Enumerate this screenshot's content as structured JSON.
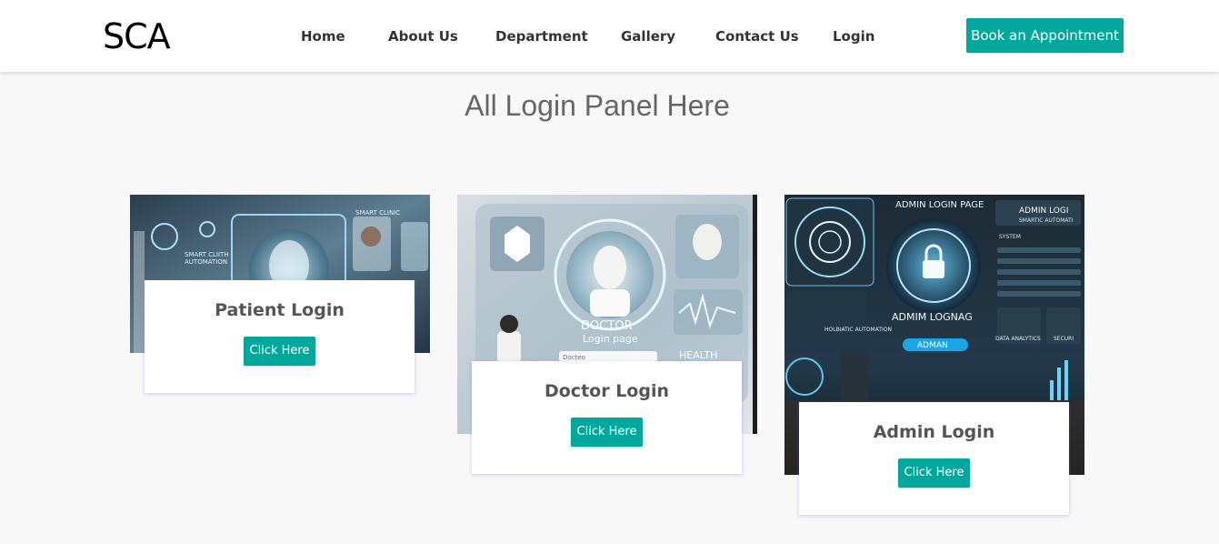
{
  "brand": {
    "logo": "SCA"
  },
  "nav": {
    "items": [
      {
        "label": "Home"
      },
      {
        "label": "About Us"
      },
      {
        "label": "Department"
      },
      {
        "label": "Gallery"
      },
      {
        "label": "Contact Us"
      },
      {
        "label": "Login"
      }
    ],
    "cta_label": "Book an Appointment"
  },
  "page": {
    "title": "All Login Panel Here"
  },
  "cards": [
    {
      "title": "Patient Login",
      "button": "Click Here",
      "image_text": {
        "line1": "SMART CLINIC",
        "line2": "SMART CLIITH",
        "line3": "AUTOMATION"
      }
    },
    {
      "title": "Doctor Login",
      "button": "Click Here",
      "image_text": {
        "line1": "DOCTOR",
        "line2": "Login page",
        "line3": "HEALTH",
        "line4": "Docteo"
      }
    },
    {
      "title": "Admin Login",
      "button": "Click Here",
      "image_text": {
        "line1": "ADMIN LOGIN PAGE",
        "line2": "ADMIN LOGI",
        "line3": "SMARTIC AUTOMATI",
        "line4": "ADMIM LOGNAG",
        "line5": "ADMAN",
        "line6": "DATA ANALYTICS",
        "line7": "SYSTEM",
        "line8": "HOLBIATIC AUTOMATION",
        "line9": "SECURI"
      }
    }
  ],
  "colors": {
    "accent": "#00a89b",
    "background": "#f8f8f8",
    "header": "#ffffff"
  }
}
